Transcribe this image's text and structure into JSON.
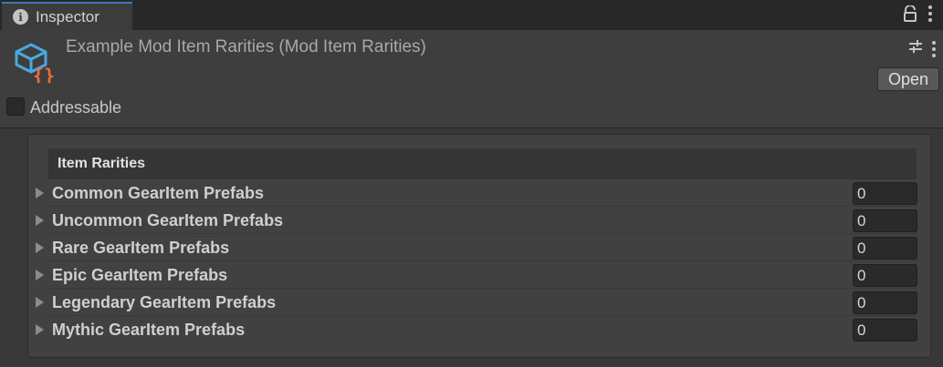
{
  "tab": {
    "label": "Inspector",
    "icon": "info-icon"
  },
  "header": {
    "title": "Example Mod Item Rarities (Mod Item Rarities)",
    "open_label": "Open",
    "addressable_label": "Addressable",
    "addressable_checked": false
  },
  "panel": {
    "section_title": "Item Rarities",
    "rows": [
      {
        "label": "Common GearItem Prefabs",
        "value": "0"
      },
      {
        "label": "Uncommon GearItem Prefabs",
        "value": "0"
      },
      {
        "label": "Rare GearItem Prefabs",
        "value": "0"
      },
      {
        "label": "Epic GearItem Prefabs",
        "value": "0"
      },
      {
        "label": "Legendary GearItem Prefabs",
        "value": "0"
      },
      {
        "label": "Mythic GearItem Prefabs",
        "value": "0"
      }
    ]
  },
  "colors": {
    "accent": "#3a79bb",
    "asset_icon_blue": "#4aa8e0",
    "asset_icon_orange": "#f26b3a"
  }
}
